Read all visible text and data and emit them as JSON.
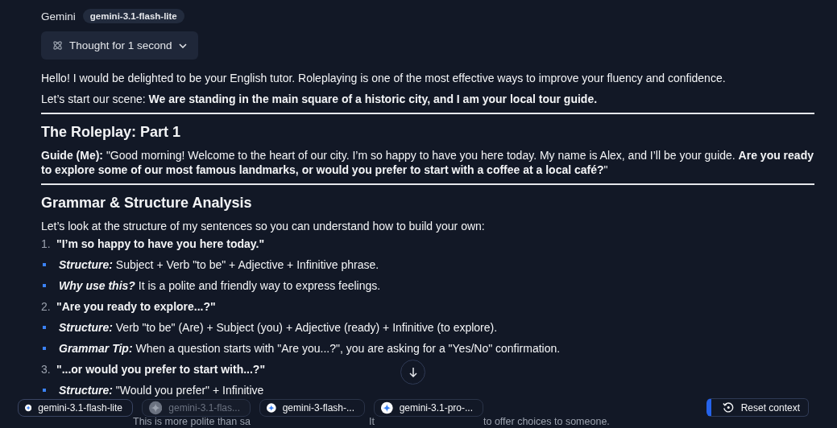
{
  "header": {
    "name": "Gemini",
    "model": "gemini-3.1-flash-lite"
  },
  "thought": {
    "label": "Thought for 1 second",
    "expanded": false
  },
  "blocks": [
    {
      "kind": "paragraph",
      "text": "Hello! I would be delighted to be your English tutor. Roleplaying is one of the most effective ways to improve your fluency and confidence."
    },
    {
      "kind": "paragraph",
      "text": "Let’s start our scene: **We are standing in the main square of a historic city, and I am your local tour guide.**"
    },
    {
      "kind": "rule"
    },
    {
      "kind": "heading",
      "text": "The Roleplay: Part 1"
    },
    {
      "kind": "paragraph",
      "text": "**Guide (Me):** \"Good morning! Welcome to the heart of our city. I’m so happy to have you here today. My name is Alex, and I’ll be your guide. **Are you ready to explore some of our most famous landmarks, or would you prefer to start with a coffee at a local café?**\""
    },
    {
      "kind": "rule"
    },
    {
      "kind": "heading",
      "text": "Grammar & Structure Analysis"
    },
    {
      "kind": "paragraph",
      "text": "Let’s look at the structure of my sentences so you can understand how to build your own:"
    },
    {
      "kind": "numbered",
      "number": "1.",
      "text": "**\"I’m so happy to have you here today.\"**"
    },
    {
      "kind": "bullet",
      "label": "Structure:",
      "text": "Subject + Verb \"to be\" + Adjective + Infinitive phrase."
    },
    {
      "kind": "bullet",
      "label": "Why use this?",
      "text": "It is a polite and friendly way to express feelings."
    },
    {
      "kind": "numbered",
      "number": "2.",
      "text": "**\"Are you ready to explore...?\"**"
    },
    {
      "kind": "bullet",
      "label": "Structure:",
      "text": "Verb \"to be\" (Are) + Subject (you) + Adjective (ready) + Infinitive (to explore)."
    },
    {
      "kind": "bullet",
      "label": "Grammar Tip:",
      "text": "When a question starts with \"Are you...?\", you are asking for a \"Yes/No\" confirmation."
    },
    {
      "kind": "numbered",
      "number": "3.",
      "text": "**\"...or would you prefer to start with...?\"**"
    },
    {
      "kind": "bullet",
      "label": "Structure:",
      "text": "\"Would you prefer\" + Infinitive"
    },
    {
      "kind": "partial",
      "fragments": [
        "This is more polite than sa",
        "It",
        "to offer choices to someone."
      ]
    }
  ],
  "models": [
    {
      "label": "gemini-3.1-flash-lite",
      "selected": true,
      "disabled": false
    },
    {
      "label": "gemini-3.1-flas...",
      "selected": false,
      "disabled": true
    },
    {
      "label": "gemini-3-flash-...",
      "selected": false,
      "disabled": false
    },
    {
      "label": "gemini-3.1-pro-...",
      "selected": false,
      "disabled": false
    }
  ],
  "reset": {
    "label": "Reset context"
  }
}
